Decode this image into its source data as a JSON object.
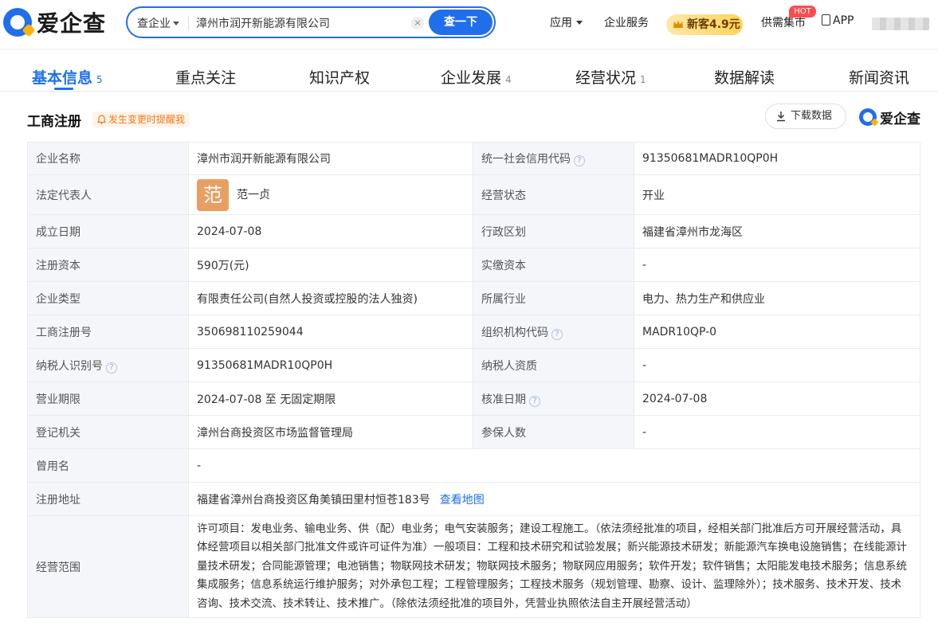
{
  "header": {
    "logo_text": "爱企查",
    "search": {
      "scope": "查企业",
      "value": "漳州市润开新能源有限公司",
      "button": "查一下",
      "clear": "×"
    },
    "nav": {
      "apps": "应用",
      "service": "企业服务",
      "promo": "新客4.9元",
      "market": "供需集市",
      "hot_badge": "HOT",
      "app": "APP"
    }
  },
  "tabs": [
    {
      "label": "基本信息",
      "count": "5"
    },
    {
      "label": "重点关注",
      "count": ""
    },
    {
      "label": "知识产权",
      "count": ""
    },
    {
      "label": "企业发展",
      "count": "4"
    },
    {
      "label": "经营状况",
      "count": "1"
    },
    {
      "label": "数据解读",
      "count": ""
    },
    {
      "label": "新闻资讯",
      "count": ""
    }
  ],
  "section": {
    "title": "工商注册",
    "remind": "发生变更时提醒我",
    "download": "下载数据",
    "brand": "爱企查"
  },
  "registration": {
    "company_name_label": "企业名称",
    "company_name": "漳州市润开新能源有限公司",
    "credit_code_label": "统一社会信用代码",
    "credit_code": "91350681MADR10QP0H",
    "legal_rep_label": "法定代表人",
    "legal_rep_avatar": "范",
    "legal_rep": "范一贞",
    "status_label": "经营状态",
    "status": "开业",
    "founded_label": "成立日期",
    "founded": "2024-07-08",
    "region_label": "行政区划",
    "region": "福建省漳州市龙海区",
    "capital_label": "注册资本",
    "capital": "590万(元)",
    "paid_capital_label": "实缴资本",
    "paid_capital": "-",
    "type_label": "企业类型",
    "type": "有限责任公司(自然人投资或控股的法人独资)",
    "industry_label": "所属行业",
    "industry": "电力、热力生产和供应业",
    "reg_no_label": "工商注册号",
    "reg_no": "350698110259044",
    "org_code_label": "组织机构代码",
    "org_code": "MADR10QP-0",
    "tax_id_label": "纳税人识别号",
    "tax_id": "91350681MADR10QP0H",
    "taxpayer_label": "纳税人资质",
    "taxpayer": "-",
    "term_label": "营业期限",
    "term": "2024-07-08 至 无固定期限",
    "approval_label": "核准日期",
    "approval": "2024-07-08",
    "authority_label": "登记机关",
    "authority": "漳州台商投资区市场监督管理局",
    "insured_label": "参保人数",
    "insured": "-",
    "former_name_label": "曾用名",
    "former_name": "-",
    "address_label": "注册地址",
    "address": "福建省漳州台商投资区角美镇田里村恒苍183号",
    "map_link": "查看地图",
    "scope_label": "经营范围",
    "scope": "许可项目：发电业务、输电业务、供（配）电业务；电气安装服务；建设工程施工。（依法须经批准的项目，经相关部门批准后方可开展经营活动，具体经营项目以相关部门批准文件或许可证件为准）一般项目：工程和技术研究和试验发展；新兴能源技术研发；新能源汽车换电设施销售；在线能源计量技术研发；合同能源管理；电池销售；物联网技术研发；物联网技术服务；物联网应用服务；软件开发；软件销售；太阳能发电技术服务；信息系统集成服务；信息系统运行维护服务；对外承包工程；工程管理服务；工程技术服务（规划管理、勘察、设计、监理除外）；技术服务、技术开发、技术咨询、技术交流、技术转让、技术推广。（除依法须经批准的项目外，凭营业执照依法自主开展经营活动）"
  }
}
